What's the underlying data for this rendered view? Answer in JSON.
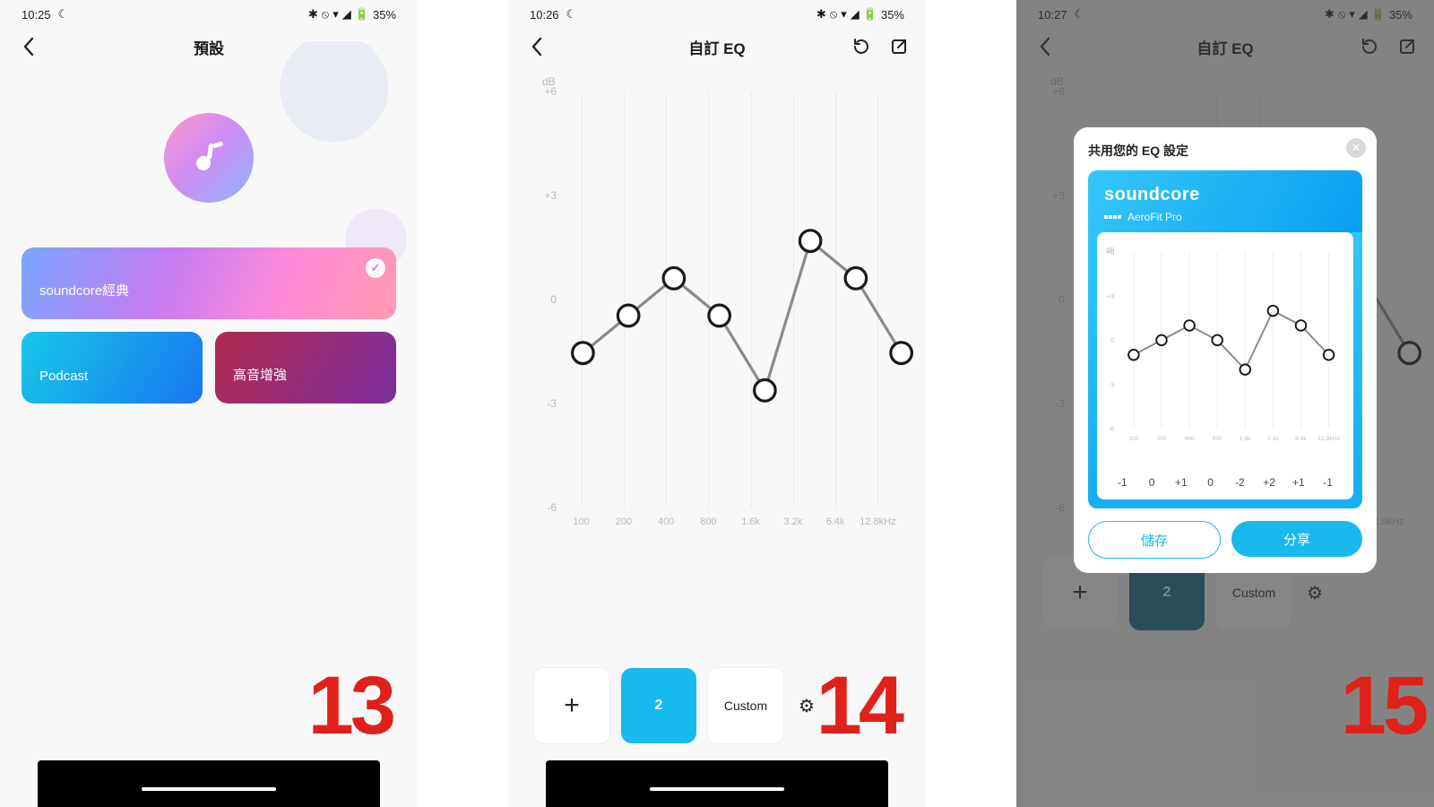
{
  "status": {
    "times": [
      "10:25",
      "10:26",
      "10:27"
    ],
    "moon": "☾",
    "icons": {
      "bt": "✱",
      "dnd": "⦸",
      "wifi": "▾",
      "signal": "◢",
      "batt": "🔋"
    },
    "battery": "35%"
  },
  "s13": {
    "title": "預設",
    "preset_classic": "soundcore經典",
    "preset_podcast": "Podcast",
    "preset_treble": "高音增強",
    "num": "13"
  },
  "s14": {
    "title": "自訂 EQ",
    "db_label": "dB",
    "slot_active": "2",
    "slot_custom": "Custom",
    "num": "14"
  },
  "s15": {
    "title": "自訂 EQ",
    "modal_title": "共用您的 EQ 設定",
    "brand": "soundcore",
    "device": "AeroFit Pro",
    "btn_save": "儲存",
    "btn_share": "分享",
    "num": "15"
  },
  "chart_data": {
    "type": "line",
    "title": "Custom EQ",
    "xlabel": "Hz",
    "ylabel": "dB",
    "ylim": [
      -6,
      6
    ],
    "y_ticks": [
      6,
      3,
      0,
      -3,
      -6
    ],
    "y_tick_labels": [
      "+6",
      "+3",
      "0",
      "-3",
      "-6"
    ],
    "categories": [
      "100",
      "200",
      "400",
      "800",
      "1.6k",
      "3.2k",
      "6.4k",
      "12.8kHz"
    ],
    "values": [
      -1,
      0,
      1,
      0,
      -2,
      2,
      1,
      -1
    ],
    "share_values_labels": [
      "-1",
      "0",
      "+1",
      "0",
      "-2",
      "+2",
      "+1",
      "-1"
    ]
  }
}
